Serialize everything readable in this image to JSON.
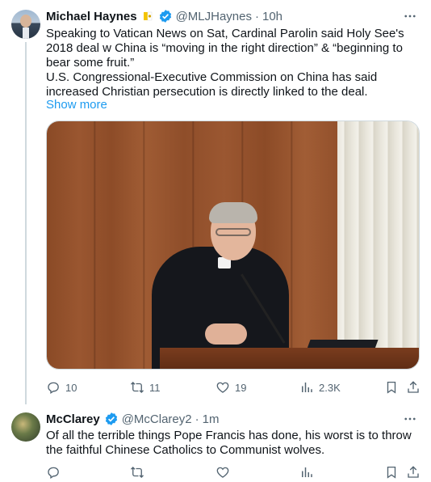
{
  "tweets": [
    {
      "name": "Michael Haynes",
      "handle": "@MLJHaynes",
      "time": "10h",
      "text_lines": [
        "Speaking to Vatican News on Sat, Cardinal Parolin said Holy See's 2018 deal w China is “moving in the right direction” & “beginning to bear some fruit.”",
        "U.S. Congressional-Executive Commission on China has said increased Christian persecution is directly linked to the deal."
      ],
      "show_more": "Show more",
      "replies": "10",
      "reposts": "11",
      "likes": "19",
      "views": "2.3K"
    },
    {
      "name": "McClarey",
      "handle": "@McClarey2",
      "time": "1m",
      "text": "Of all the terrible things Pope Francis has done, his worst is to throw the faithful Chinese Catholics to Communist wolves."
    }
  ],
  "colors": {
    "text": "#0f1419",
    "secondary": "#536471",
    "link": "#1d9bf0",
    "verified": "#1d9bf0",
    "divider": "#cfd9de"
  },
  "icons": [
    "verified-badge-icon",
    "flag-emoji-icon",
    "more-icon",
    "reply-icon",
    "repost-icon",
    "like-icon",
    "views-icon",
    "bookmark-icon",
    "share-icon"
  ]
}
